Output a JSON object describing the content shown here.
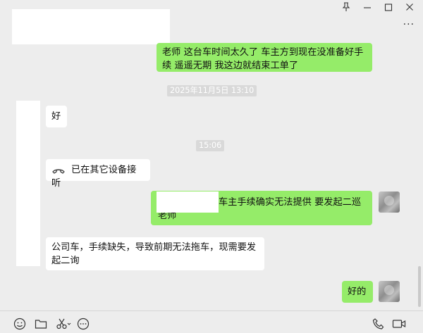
{
  "window": {
    "pin_icon": "pin-icon",
    "minimize_icon": "minimize-icon",
    "maximize_icon": "maximize-icon",
    "close_icon": "close-icon",
    "more_label": "···"
  },
  "messages": [
    {
      "side": "right",
      "text": "老师  这台车时间太久了   车主方到现在没准备好手续   遥遥无期     我这边就结束工单了"
    },
    {
      "side": "left",
      "text": "好"
    },
    {
      "side": "left",
      "text": "已在其它设备接听",
      "icon": "phone-hangup-icon"
    },
    {
      "side": "right",
      "text": "车主手续确实无法提供  要发起二巡 老师"
    },
    {
      "side": "left",
      "text": "公司车，手续缺失，导致前期无法拖车，现需要发起二询"
    },
    {
      "side": "right",
      "text": "好的"
    }
  ],
  "timestamps": [
    "2025年11月5日 13:10",
    "15:06"
  ],
  "toolbar": {
    "left": [
      "emoji-icon",
      "folder-icon",
      "scissors-icon",
      "chat-history-icon"
    ],
    "right": [
      "voice-call-icon",
      "video-call-icon"
    ]
  },
  "colors": {
    "background": "#ededed",
    "sent_bubble": "#95ec69",
    "received_bubble": "#ffffff"
  }
}
